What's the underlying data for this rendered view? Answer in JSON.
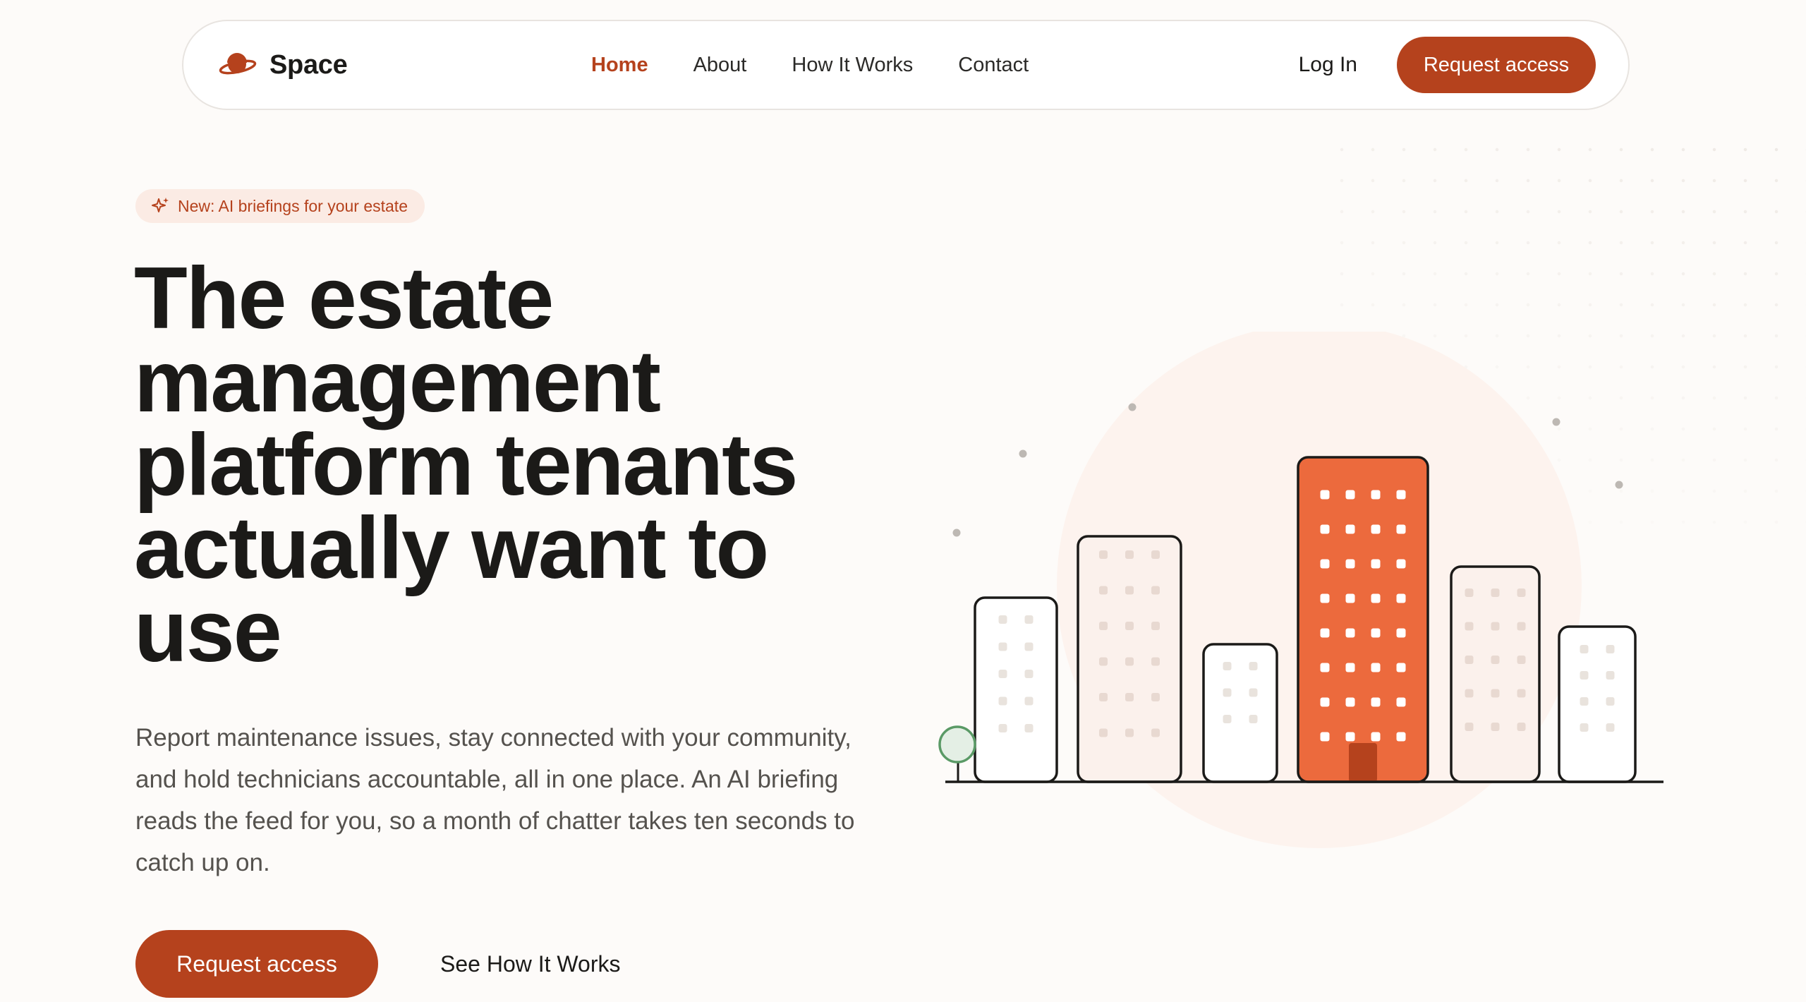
{
  "brand": {
    "name": "Space",
    "logo_icon": "planet-icon",
    "accent": "#b5421d"
  },
  "nav": {
    "links": [
      {
        "label": "Home",
        "active": true
      },
      {
        "label": "About",
        "active": false
      },
      {
        "label": "How It Works",
        "active": false
      },
      {
        "label": "Contact",
        "active": false
      }
    ],
    "login_label": "Log In",
    "request_label": "Request access"
  },
  "hero": {
    "badge_icon": "sparkle-icon",
    "badge": "New: AI briefings for your estate",
    "headline": "The estate management platform tenants actually want to use",
    "lead": "Report maintenance issues, stay connected with your community, and hold technicians accountable, all in one place. An AI briefing reads the feed for you, so a month of chatter takes ten seconds to catch up on.",
    "cta_primary": "Request access",
    "cta_secondary": "See How It Works"
  },
  "colors": {
    "accent": "#b5421d",
    "highlight_building": "#ec6a3d",
    "background": "#fdfbf9",
    "badge_bg": "#fbebe4"
  }
}
